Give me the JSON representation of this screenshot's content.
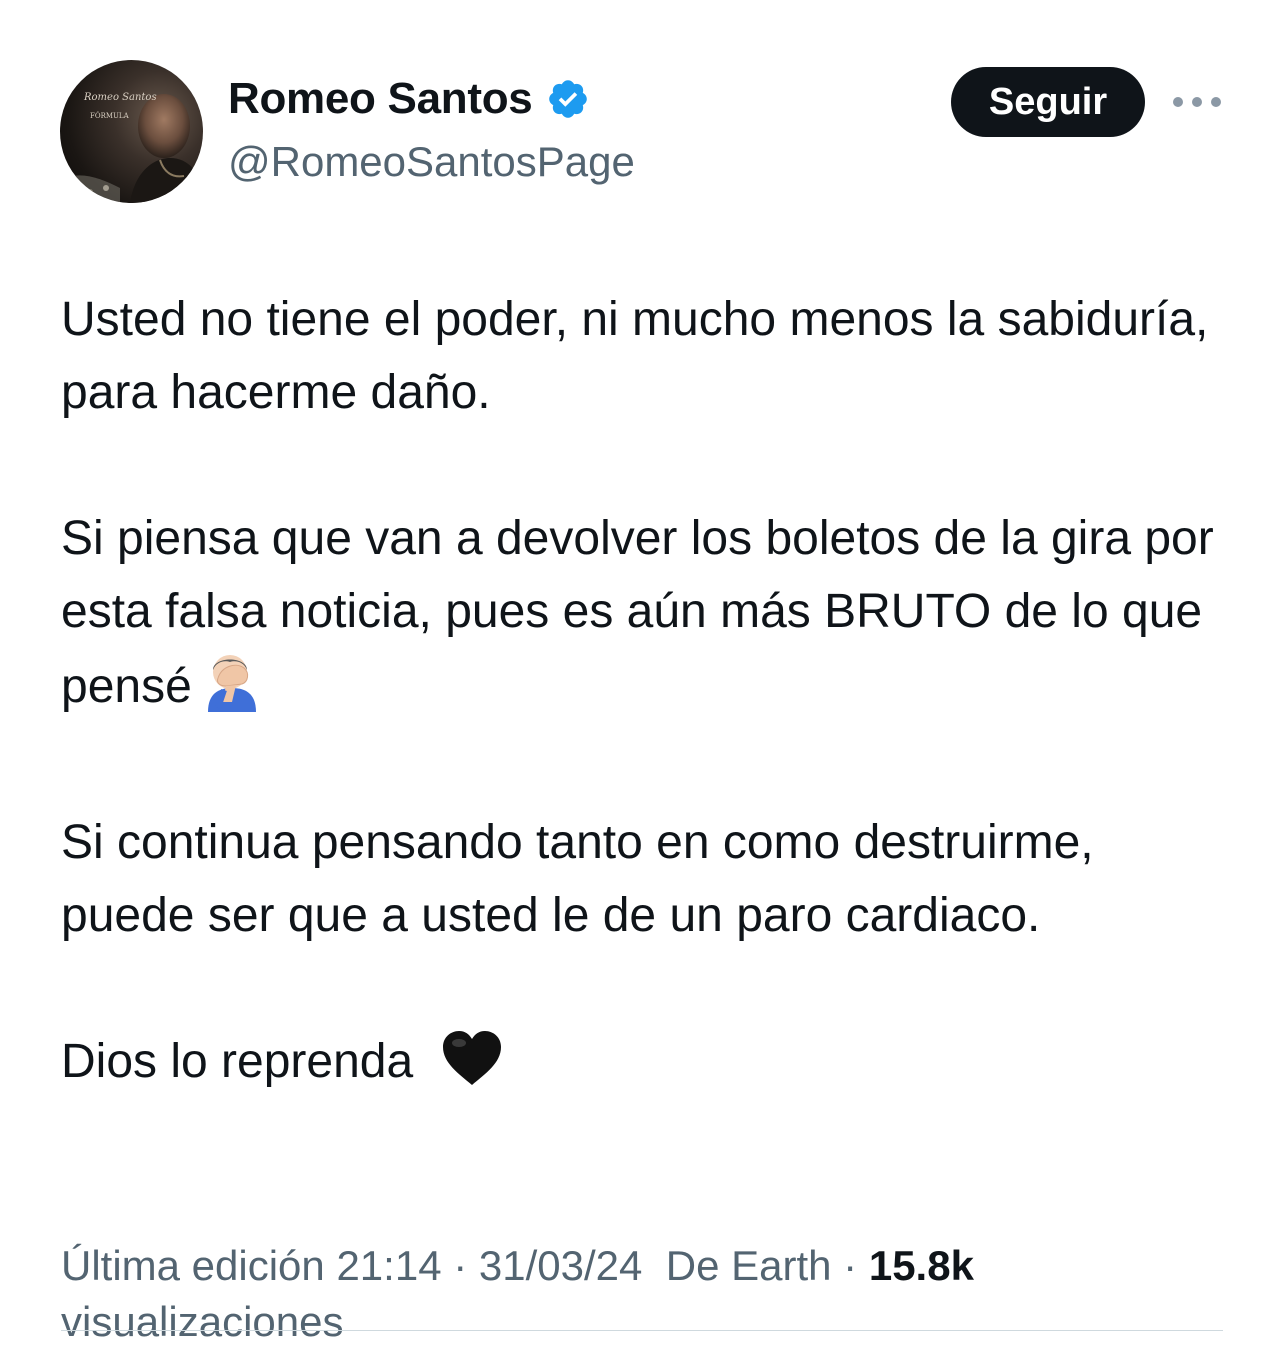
{
  "author": {
    "display_name": "Romeo Santos",
    "handle": "@RomeoSantosPage",
    "verified": true,
    "avatar_text": {
      "script_name": "Romeo Santos",
      "album": "FÓRMULA"
    }
  },
  "actions": {
    "follow_label": "Seguir",
    "more_icon": "more-horizontal-icon"
  },
  "tweet": {
    "paragraph_1": "Usted no tiene el poder, ni mucho menos la sabiduría, para hacerme daño.",
    "paragraph_2": "Si piensa que van a devolver los boletos de la gira por esta falsa noticia, pues es aún más BRUTO de lo que pensé",
    "paragraph_2_emoji": "facepalm-emoji",
    "paragraph_3": "Si continua pensando tanto en como destruirme, puede ser que a usted le de un paro cardiaco.",
    "paragraph_4": "Dios lo reprenda",
    "paragraph_4_emoji": "black-heart-emoji"
  },
  "meta": {
    "edited_label": "Última edición",
    "time": "21:14",
    "separator": "·",
    "date": "31/03/24",
    "source": "De Earth",
    "views_count": "15.8k",
    "views_label": "visualizaciones"
  },
  "colors": {
    "text": "#0f1419",
    "secondary": "#536471",
    "verified_blue": "#1d9bf0",
    "button_bg": "#0f1419",
    "divider": "#cfd9de"
  }
}
